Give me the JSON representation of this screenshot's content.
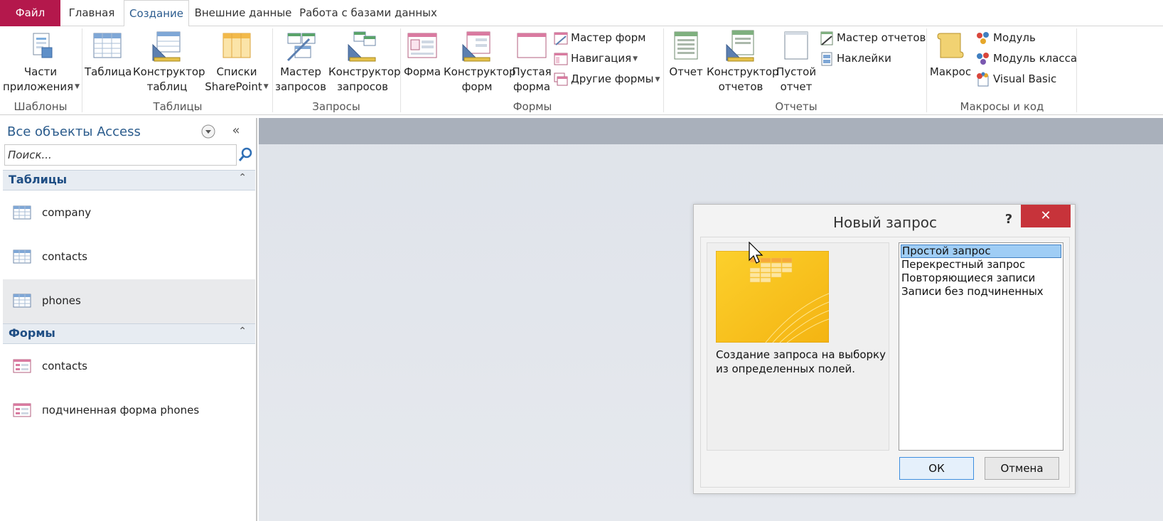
{
  "tabs": {
    "file": "Файл",
    "home": "Главная",
    "create": "Создание",
    "external": "Внешние данные",
    "dbtools": "Работа с базами данных"
  },
  "ribbon": {
    "groups": {
      "templates": "Шаблоны",
      "tables": "Таблицы",
      "queries": "Запросы",
      "forms": "Формы",
      "reports": "Отчеты",
      "macros": "Макросы и код"
    },
    "app_parts": [
      "Части",
      "приложения"
    ],
    "table": "Таблица",
    "table_designer": [
      "Конструктор",
      "таблиц"
    ],
    "sharepoint_lists": [
      "Списки",
      "SharePoint"
    ],
    "query_wizard": [
      "Мастер",
      "запросов"
    ],
    "query_designer": [
      "Конструктор",
      "запросов"
    ],
    "form": "Форма",
    "form_designer": [
      "Конструктор",
      "форм"
    ],
    "blank_form": [
      "Пустая",
      "форма"
    ],
    "form_wizard": "Мастер форм",
    "navigation": "Навигация",
    "more_forms": "Другие формы",
    "report": "Отчет",
    "report_designer": [
      "Конструктор",
      "отчетов"
    ],
    "blank_report": [
      "Пустой",
      "отчет"
    ],
    "report_wizard": "Мастер отчетов",
    "labels": "Наклейки",
    "macro": "Макрос",
    "module": "Модуль",
    "class_module": "Модуль класса",
    "visual_basic": "Visual Basic"
  },
  "nav": {
    "title": "Все объекты Access",
    "search_placeholder": "Поиск...",
    "sections": [
      {
        "title": "Таблицы",
        "items": [
          "company",
          "contacts",
          "phones"
        ]
      },
      {
        "title": "Формы",
        "items": [
          "contacts",
          "подчиненная форма phones"
        ]
      }
    ],
    "selected_item": "phones"
  },
  "dialog": {
    "title": "Новый запрос",
    "help": "?",
    "close": "✕",
    "description_line1": "Создание запроса на выборку",
    "description_line2": "из определенных полей.",
    "options": [
      "Простой запрос",
      "Перекрестный запрос",
      "Повторяющиеся записи",
      "Записи без подчиненных"
    ],
    "selected_option": "Простой запрос",
    "ok": "ОК",
    "cancel": "Отмена"
  },
  "colors": {
    "file_tab": "#b4184c",
    "accent_text": "#2a5b8c",
    "close_button": "#c7333a",
    "list_selection": "#9fcdf5"
  }
}
